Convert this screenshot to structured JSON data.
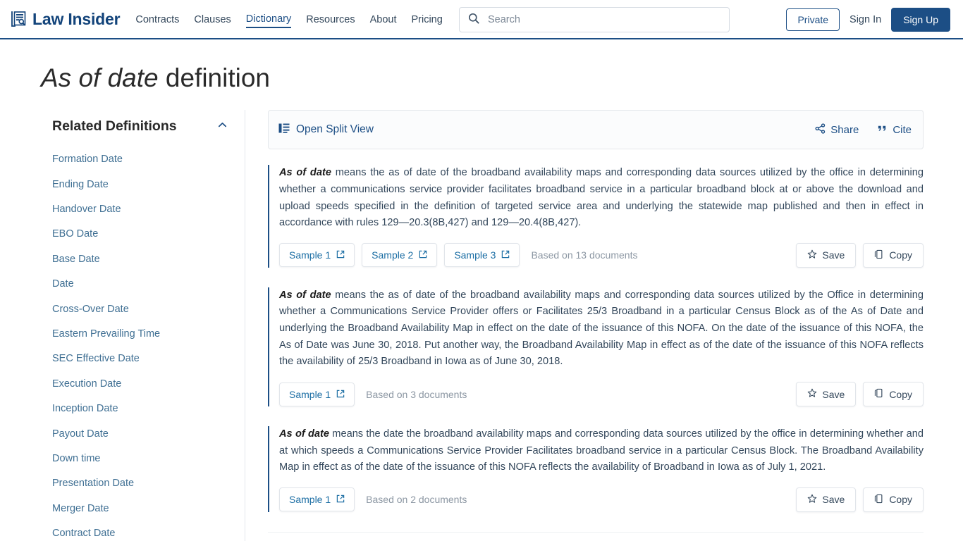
{
  "header": {
    "logo_text": "Law Insider",
    "logo_icon": "document-search-icon",
    "nav": [
      {
        "label": "Contracts",
        "active": false
      },
      {
        "label": "Clauses",
        "active": false
      },
      {
        "label": "Dictionary",
        "active": true
      },
      {
        "label": "Resources",
        "active": false
      },
      {
        "label": "About",
        "active": false
      },
      {
        "label": "Pricing",
        "active": false
      }
    ],
    "search": {
      "placeholder": "Search",
      "value": "",
      "icon": "search-icon"
    },
    "private_label": "Private",
    "signin_label": "Sign In",
    "signup_label": "Sign Up",
    "accent_color": "#1c4e85"
  },
  "page": {
    "title_term": "As of date",
    "title_suffix": " definition"
  },
  "sidebar": {
    "title": "Related Definitions",
    "collapse_icon": "chevron-up-icon",
    "items": [
      {
        "label": "Formation Date"
      },
      {
        "label": "Ending Date"
      },
      {
        "label": "Handover Date"
      },
      {
        "label": "EBO Date"
      },
      {
        "label": "Base Date"
      },
      {
        "label": "Date"
      },
      {
        "label": "Cross-Over Date"
      },
      {
        "label": "Eastern Prevailing Time"
      },
      {
        "label": "SEC Effective Date"
      },
      {
        "label": "Execution Date"
      },
      {
        "label": "Inception Date"
      },
      {
        "label": "Payout Date"
      },
      {
        "label": "Down time"
      },
      {
        "label": "Presentation Date"
      },
      {
        "label": "Merger Date"
      },
      {
        "label": "Contract Date"
      }
    ]
  },
  "toolbar": {
    "split_view_label": "Open Split View",
    "split_view_icon": "split-view-icon",
    "share_label": "Share",
    "share_icon": "share-icon",
    "cite_label": "Cite",
    "cite_icon": "quote-icon"
  },
  "definitions": [
    {
      "term": "As of date",
      "body": " means the as of date of the broadband availability maps and corresponding data sources utilized by the office in determining whether a communications service provider facilitates broadband service in a particular broadband block at or above the download and upload speeds specified in the definition of targeted service area and underlying the statewide map published and then in effect in accordance with rules 129—20.3(8B,427) and 129—20.4(8B,427).",
      "samples": [
        "Sample 1",
        "Sample 2",
        "Sample 3"
      ],
      "based_on": "Based on 13 documents",
      "save_label": "Save",
      "copy_label": "Copy"
    },
    {
      "term": "As of date",
      "body": " means the as of date of the broadband availability maps and corresponding data sources utilized by the Office in determining whether a Communications Service Provider offers or Facilitates 25/3 Broadband in a particular Census Block as of the As of Date and underlying the Broadband Availability Map in effect on the date of the issuance of this NOFA. On the date of the issuance of this NOFA, the As of Date was June 30, 2018. Put another way, the Broadband Availability Map in effect as of the date of the issuance of this NOFA reflects the availability of 25/3 Broadband in Iowa as of June 30, 2018.",
      "samples": [
        "Sample 1"
      ],
      "based_on": "Based on 3 documents",
      "save_label": "Save",
      "copy_label": "Copy"
    },
    {
      "term": "As of date",
      "body": " means the date the broadband availability maps and corresponding data sources utilized by the office in determining whether and at which speeds a Communications Service Provider Facilitates broadband service in a particular Census Block. The Broadband Availability Map in effect as of the date of the issuance of this NOFA reflects the availability of Broadband in Iowa as of July 1, 2021.",
      "samples": [
        "Sample 1"
      ],
      "based_on": "Based on 2 documents",
      "save_label": "Save",
      "copy_label": "Copy"
    }
  ]
}
